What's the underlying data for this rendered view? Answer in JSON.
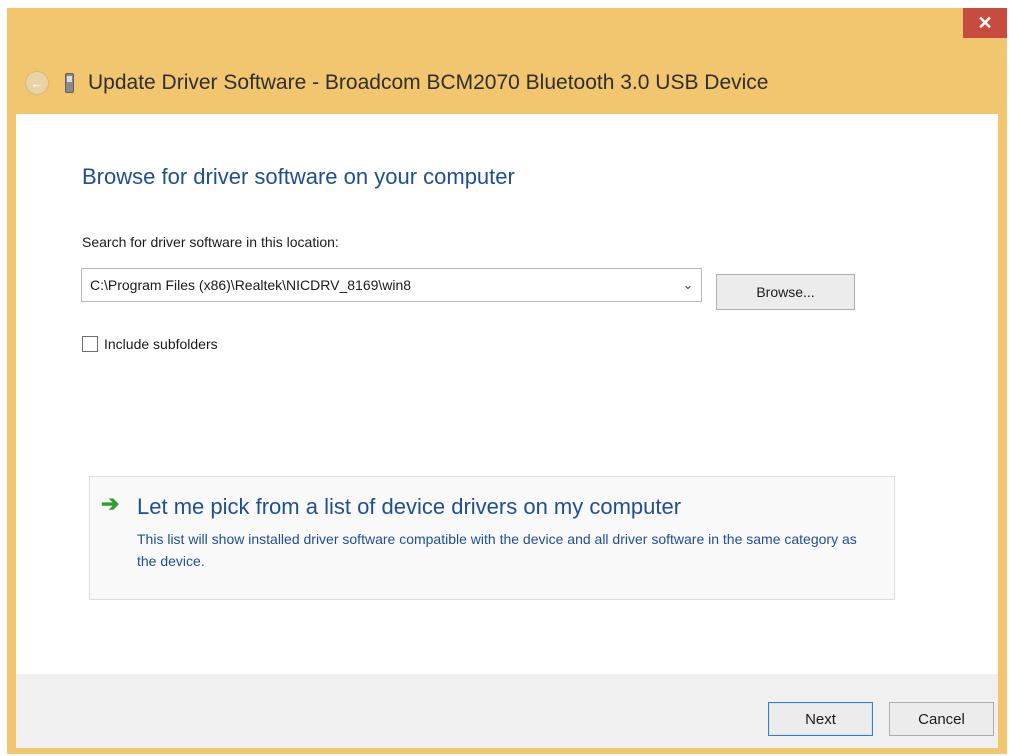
{
  "window": {
    "title": "Update Driver Software - Broadcom BCM2070 Bluetooth 3.0 USB Device",
    "close_glyph": "✕",
    "back_glyph": "←",
    "frame_color": "#f2c56f"
  },
  "main": {
    "heading": "Browse for driver software on your computer",
    "search_label": "Search for driver software in this location:",
    "path_value": "C:\\Program Files (x86)\\Realtek\\NICDRV_8169\\win8",
    "dropdown_glyph": "⌄",
    "browse_label": "Browse...",
    "include_subfolders": {
      "label": "Include subfolders",
      "checked": false
    },
    "pick_option": {
      "arrow_glyph": "➔",
      "title": "Let me pick from a list of device drivers on my computer",
      "description": "This list will show installed driver software compatible with the device and all driver software in the same category as the device."
    }
  },
  "footer": {
    "next_label": "Next",
    "cancel_label": "Cancel"
  },
  "icons": {
    "back": "back-arrow-icon",
    "device": "usb-device-icon",
    "close": "close-icon",
    "dropdown": "chevron-down-icon",
    "pick": "green-arrow-icon"
  }
}
